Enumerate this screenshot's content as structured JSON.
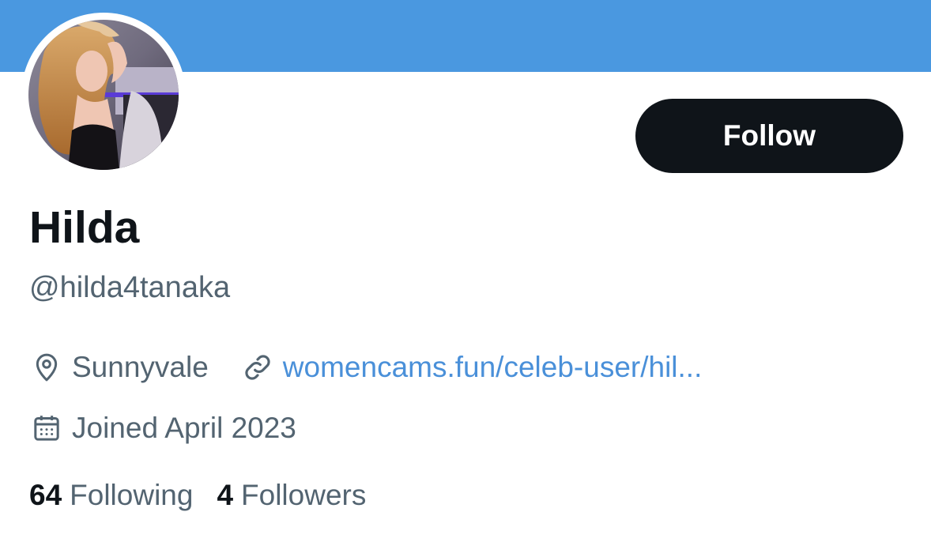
{
  "colors": {
    "banner": "#4a98e0",
    "follow_button_bg": "#0f1419",
    "link": "#4a90d9",
    "secondary_text": "#536471",
    "primary_text": "#0f1419"
  },
  "profile": {
    "display_name": "Hilda",
    "handle": "@hilda4tanaka",
    "avatar_icon": "profile-photo",
    "follow_label": "Follow",
    "location": "Sunnyvale",
    "location_icon": "location-pin-icon",
    "website": "womencams.fun/celeb-user/hil...",
    "website_icon": "link-icon",
    "joined": "Joined April 2023",
    "joined_icon": "calendar-icon"
  },
  "stats": {
    "following_count": "64",
    "following_label": "Following",
    "followers_count": "4",
    "followers_label": "Followers"
  }
}
